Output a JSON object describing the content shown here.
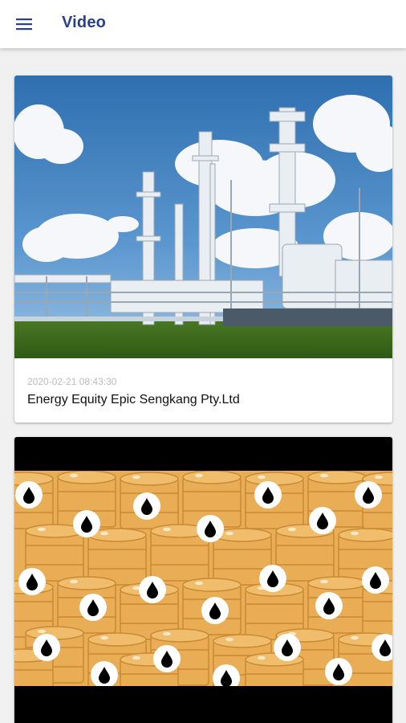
{
  "header": {
    "title": "Video",
    "menu_icon": "hamburger-menu-icon"
  },
  "videos": [
    {
      "date": "2020-02-21 08:43:30",
      "title": "Energy Equity Epic Sengkang Pty.Ltd",
      "thumbnail": "gas-processing-plant-photo"
    },
    {
      "date": "",
      "title": "",
      "thumbnail": "oil-barrels-illustration"
    }
  ],
  "colors": {
    "accent": "#2b3f8f",
    "background": "#f0f0f0",
    "barrel": "#e8ad55",
    "drop_icon": "#000000"
  }
}
